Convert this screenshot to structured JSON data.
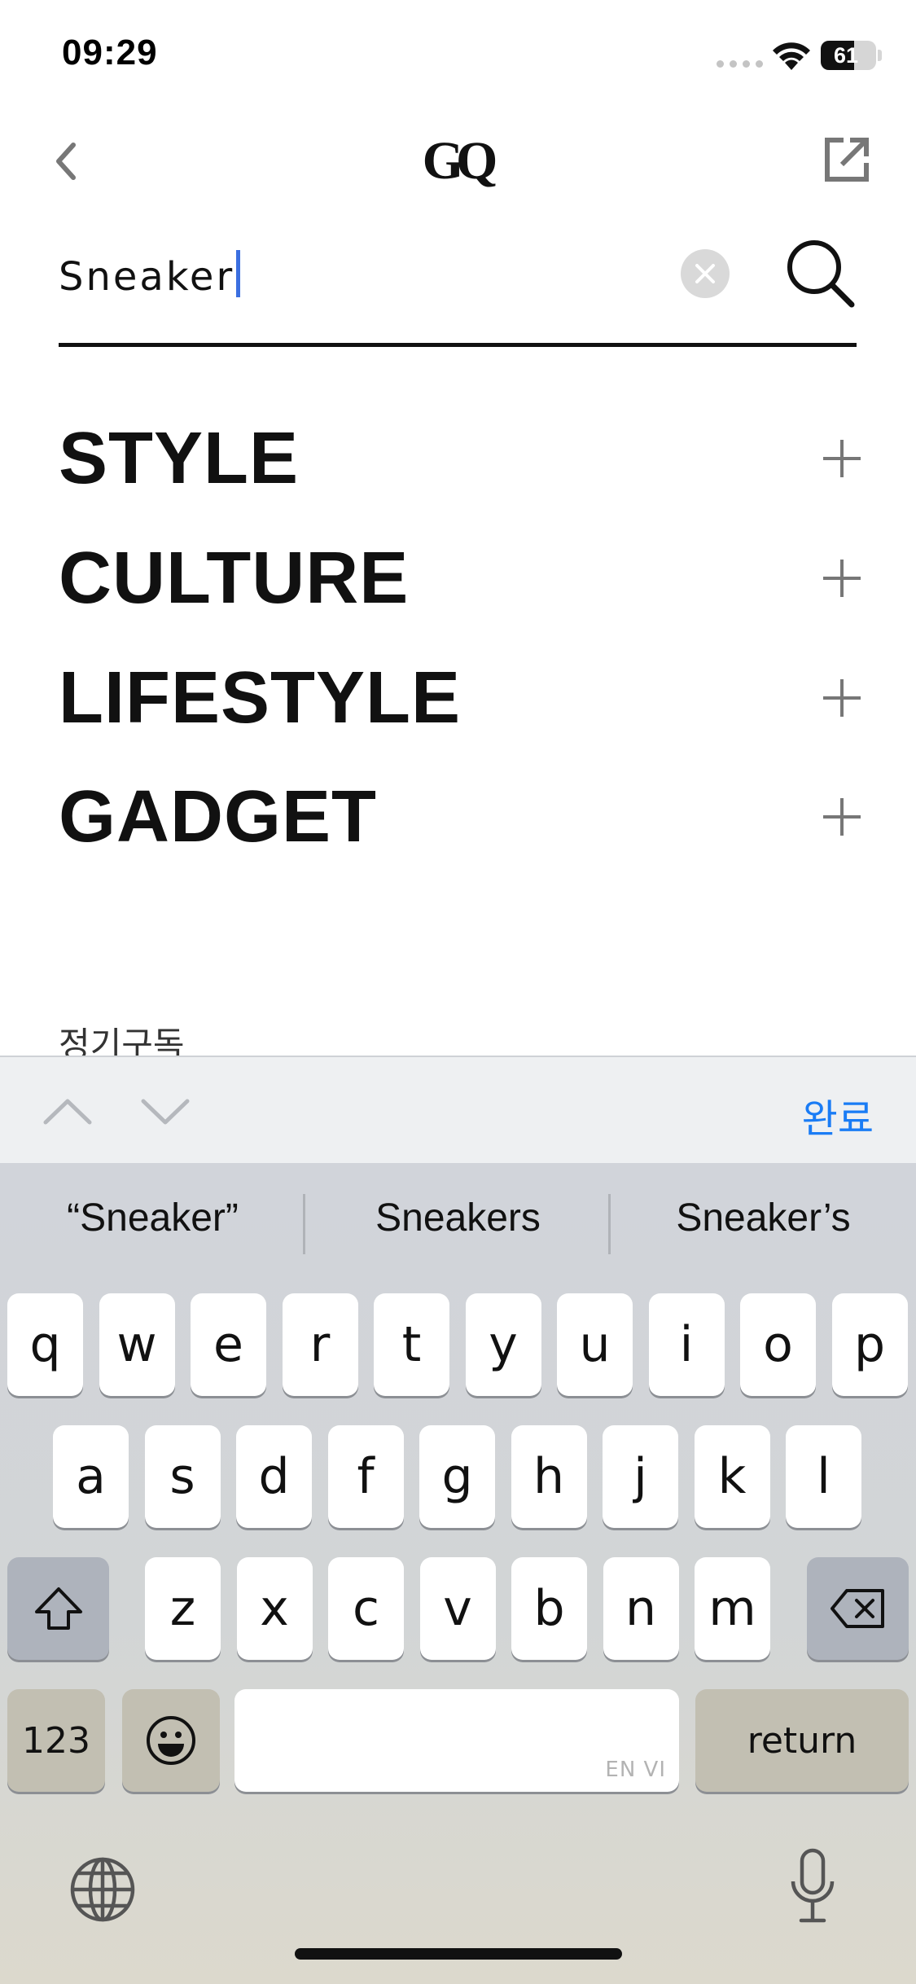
{
  "status": {
    "time": "09:29",
    "battery": "61",
    "battery_level": 0.61
  },
  "nav": {
    "logo": "GQ"
  },
  "search": {
    "value": "Sneaker",
    "placeholder": ""
  },
  "menu": {
    "items": [
      {
        "label": "STYLE"
      },
      {
        "label": "CULTURE"
      },
      {
        "label": "LIFESTYLE"
      },
      {
        "label": "GADGET"
      }
    ],
    "subscribe": "정기구독"
  },
  "toolbar": {
    "done": "완료"
  },
  "keyboard": {
    "suggestions": [
      "“Sneaker”",
      "Sneakers",
      "Sneaker’s"
    ],
    "row1": [
      "q",
      "w",
      "e",
      "r",
      "t",
      "y",
      "u",
      "i",
      "o",
      "p"
    ],
    "row2": [
      "a",
      "s",
      "d",
      "f",
      "g",
      "h",
      "j",
      "k",
      "l"
    ],
    "row3": [
      "z",
      "x",
      "c",
      "v",
      "b",
      "n",
      "m"
    ],
    "numbers": "123",
    "space_label": "EN VI",
    "return": "return"
  },
  "icons": {
    "back": "chevron-left-icon",
    "external": "external-link-icon",
    "clear": "clear-icon",
    "search": "search-icon",
    "shift": "shift-icon",
    "delete": "delete-icon",
    "emoji": "emoji-icon",
    "globe": "globe-icon",
    "mic": "microphone-icon"
  },
  "colors": {
    "accent": "#1a7cf5",
    "caret": "#3b6fe0"
  }
}
